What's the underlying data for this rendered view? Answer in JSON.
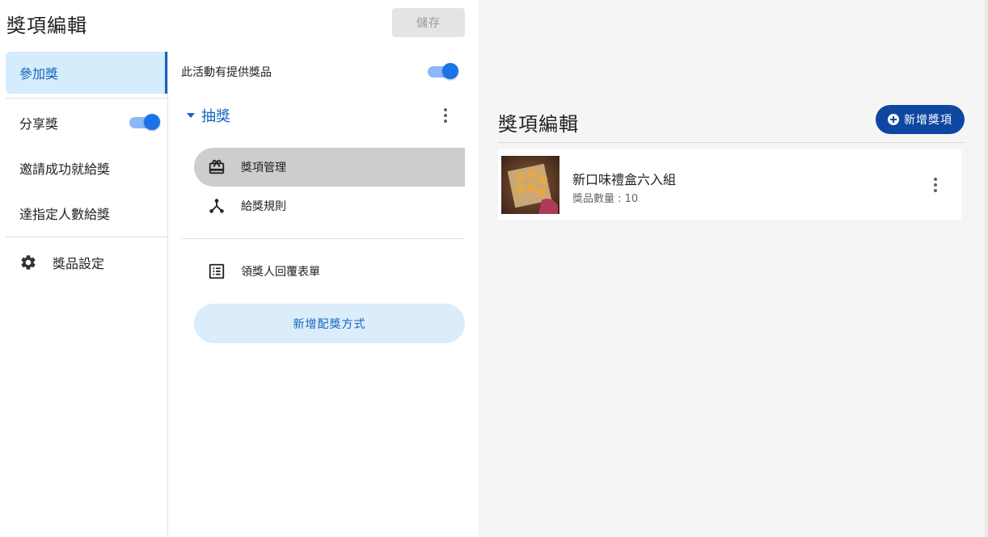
{
  "header": {
    "title": "獎項編輯",
    "save_label": "儲存"
  },
  "nav": {
    "items": [
      {
        "label": "參加獎",
        "active": true
      },
      {
        "label": "分享獎",
        "toggle_on": true
      },
      {
        "label": "邀請成功就給獎"
      },
      {
        "label": "達指定人數給獎"
      },
      {
        "label": "獎品設定",
        "icon": "gear-icon"
      }
    ]
  },
  "middle": {
    "offer_label": "此活動有提供獎品",
    "offer_toggle_on": true,
    "draw_label": "抽獎",
    "sub_items": [
      {
        "label": "獎項管理",
        "icon": "gift-icon",
        "active": true
      },
      {
        "label": "給獎規則",
        "icon": "branch-icon"
      },
      {
        "label": "領獎人回覆表單",
        "icon": "list-form-icon"
      }
    ],
    "add_method_label": "新增配獎方式"
  },
  "right": {
    "title": "獎項編輯",
    "add_award_label": "新增獎項",
    "prizes": [
      {
        "name": "新口味禮盒六入組",
        "qty_text": "獎品數量 : 10"
      }
    ]
  },
  "colors": {
    "accent": "#1565c0",
    "button_primary": "#0d47a1",
    "active_nav_bg": "#d4ecfc",
    "toggle_track": "#8ab8f8",
    "toggle_knob": "#1a73e8"
  }
}
